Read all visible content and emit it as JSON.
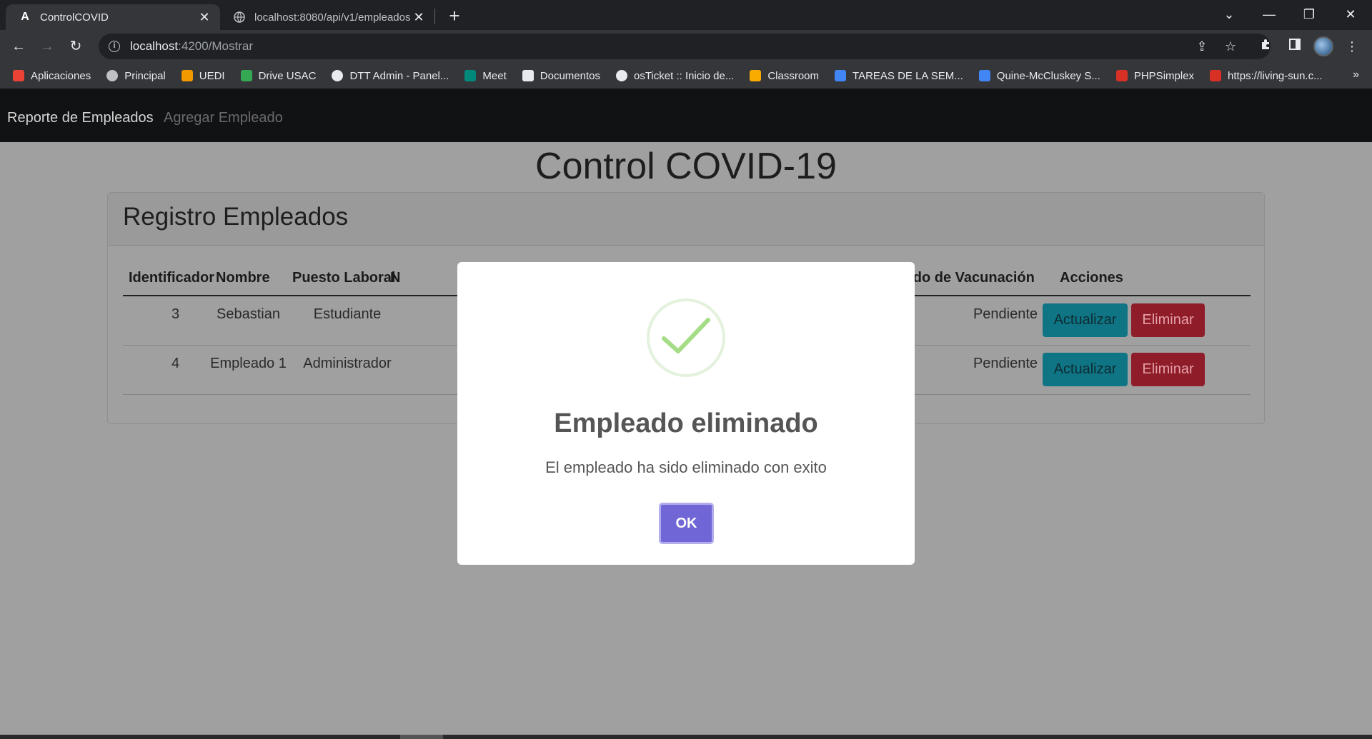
{
  "browser": {
    "tabs": [
      {
        "title": "ControlCOVID",
        "icon": "angular-icon",
        "active": true
      },
      {
        "title": "localhost:8080/api/v1/empleados",
        "icon": "globe-icon",
        "active": false
      }
    ],
    "address": {
      "host": "localhost",
      "path": ":4200/Mostrar"
    },
    "bookmarks": [
      {
        "label": "Aplicaciones",
        "icon": "apps-grid-icon",
        "color": "#ea4335"
      },
      {
        "label": "Principal",
        "icon": "principal-icon",
        "color": "#bdc1c6"
      },
      {
        "label": "UEDI",
        "icon": "uedi-icon",
        "color": "#f29900"
      },
      {
        "label": "Drive USAC",
        "icon": "drive-icon",
        "color": "#34a853"
      },
      {
        "label": "DTT Admin - Panel...",
        "icon": "globe-icon",
        "color": "#e8eaed"
      },
      {
        "label": "Meet",
        "icon": "meet-icon",
        "color": "#00897b"
      },
      {
        "label": "Documentos",
        "icon": "document-icon",
        "color": "#e8eaed"
      },
      {
        "label": "osTicket :: Inicio de...",
        "icon": "globe-icon",
        "color": "#e8eaed"
      },
      {
        "label": "Classroom",
        "icon": "classroom-icon",
        "color": "#f9ab00"
      },
      {
        "label": "TAREAS DE LA SEM...",
        "icon": "docs-icon",
        "color": "#4285f4"
      },
      {
        "label": "Quine-McCluskey S...",
        "icon": "quine-icon",
        "color": "#4285f4"
      },
      {
        "label": "PHPSimplex",
        "icon": "calendar-icon",
        "color": "#d93025"
      },
      {
        "label": "https://living-sun.c...",
        "icon": "site-icon",
        "color": "#d93025"
      }
    ],
    "more_bookmarks": "»"
  },
  "app": {
    "nav": {
      "report": "Reporte de Empleados",
      "add": "Agregar Empleado"
    },
    "title": "Control COVID-19",
    "card_title": "Registro Empleados",
    "table": {
      "headers": [
        "Identificador",
        "Nombre",
        "Puesto Laboral",
        "N",
        "tado de Vacunación",
        "Acciones"
      ],
      "rows": [
        {
          "id": "3",
          "name": "Sebastian",
          "job": "Estudiante",
          "status": "Pendiente"
        },
        {
          "id": "4",
          "name": "Empleado 1",
          "job": "Administrador",
          "status": "Pendiente"
        }
      ],
      "update_label": "Actualizar",
      "delete_label": "Eliminar"
    }
  },
  "modal": {
    "icon": "success-check-icon",
    "title": "Empleado eliminado",
    "text": "El empleado ha sido eliminado con exito",
    "ok_label": "OK",
    "accent": "#7066d6",
    "success_color": "#a5dc86"
  }
}
